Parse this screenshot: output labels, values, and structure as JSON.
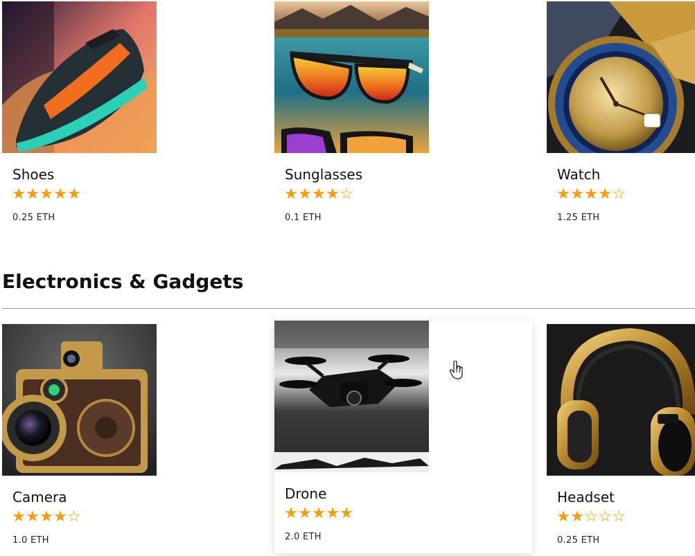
{
  "sections": [
    {
      "title": "",
      "products": [
        {
          "name": "Shoes",
          "rating": 5,
          "price": "0.25 ETH",
          "image": "sneaker-image"
        },
        {
          "name": "Sunglasses",
          "rating": 4,
          "price": "0.1 ETH",
          "image": "sunglasses-image"
        },
        {
          "name": "Watch",
          "rating": 4,
          "price": "1.25 ETH",
          "image": "watch-image"
        }
      ]
    },
    {
      "title": "Electronics & Gadgets",
      "products": [
        {
          "name": "Camera",
          "rating": 4,
          "price": "1.0 ETH",
          "image": "camera-image"
        },
        {
          "name": "Drone",
          "rating": 5,
          "price": "2.0 ETH",
          "image": "drone-image",
          "hovered": true
        },
        {
          "name": "Headset",
          "rating": 2,
          "price": "0.25 ETH",
          "image": "headset-image"
        }
      ]
    }
  ],
  "rating_max": 5,
  "colors": {
    "star": "#f59d0b",
    "text": "#111111",
    "divider": "#9a9a9a"
  },
  "icons": {
    "star_full": "star-filled-icon",
    "star_empty": "star-outline-icon",
    "cursor": "hand-pointer-icon"
  }
}
